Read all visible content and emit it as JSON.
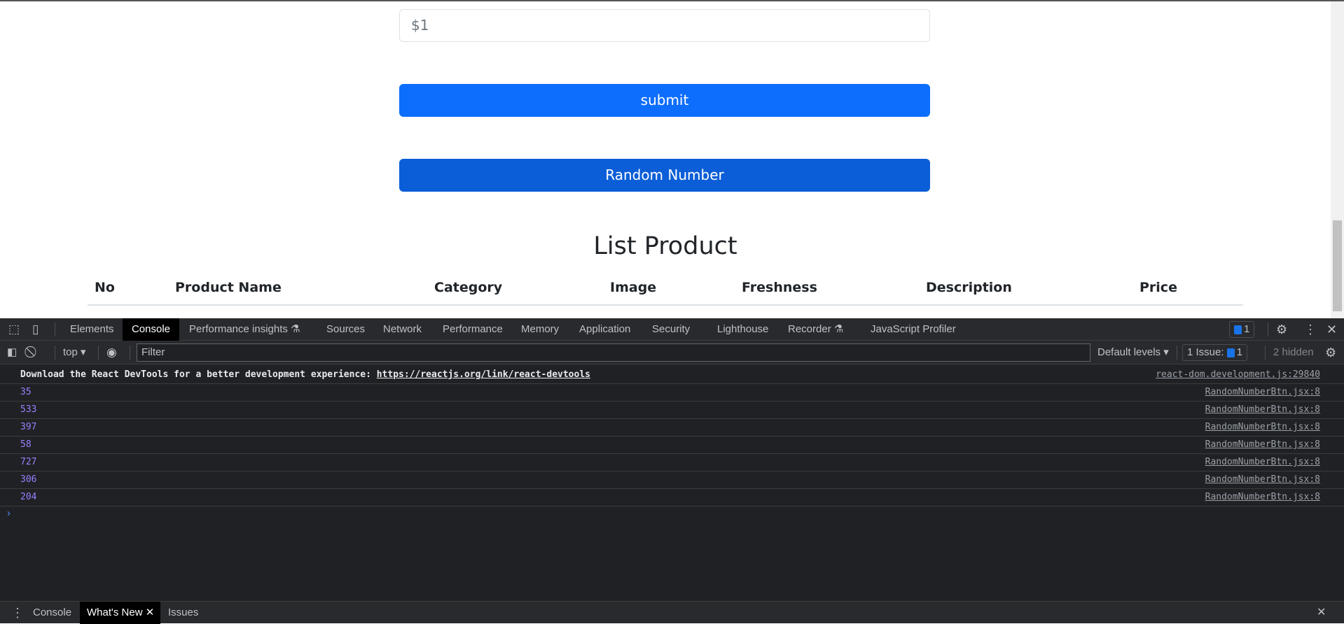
{
  "page": {
    "price_input_value": "$1",
    "submit_label": "submit",
    "random_label": "Random Number",
    "list_title": "List Product",
    "columns": [
      "No",
      "Product Name",
      "Category",
      "Image",
      "Freshness",
      "Description",
      "Price"
    ]
  },
  "devtools": {
    "tabs": [
      "Elements",
      "Console",
      "Performance insights",
      "Sources",
      "Network",
      "Performance",
      "Memory",
      "Application",
      "Security",
      "Lighthouse",
      "Recorder",
      "JavaScript Profiler"
    ],
    "active_tab": "Console",
    "issues_badge": "1",
    "context": "top",
    "filter_placeholder": "Filter",
    "levels": "Default levels",
    "issues_label": "1 Issue:",
    "issues_count": "1",
    "hidden": "2 hidden",
    "console": {
      "devtools_msg": "Download the React DevTools for a better development experience: ",
      "devtools_link": "https://reactjs.org/link/react-devtools",
      "devtools_src": "react-dom.development.js:29840",
      "logs": [
        {
          "value": "35",
          "src": "RandomNumberBtn.jsx:8"
        },
        {
          "value": "533",
          "src": "RandomNumberBtn.jsx:8"
        },
        {
          "value": "397",
          "src": "RandomNumberBtn.jsx:8"
        },
        {
          "value": "58",
          "src": "RandomNumberBtn.jsx:8"
        },
        {
          "value": "727",
          "src": "RandomNumberBtn.jsx:8"
        },
        {
          "value": "306",
          "src": "RandomNumberBtn.jsx:8"
        },
        {
          "value": "204",
          "src": "RandomNumberBtn.jsx:8"
        }
      ],
      "prompt": "›"
    },
    "drawer_tabs": [
      "Console",
      "What's New",
      "Issues"
    ],
    "colors": {
      "bg": "#202124",
      "number": "#9980ff",
      "primary": "#0d6efd"
    }
  }
}
